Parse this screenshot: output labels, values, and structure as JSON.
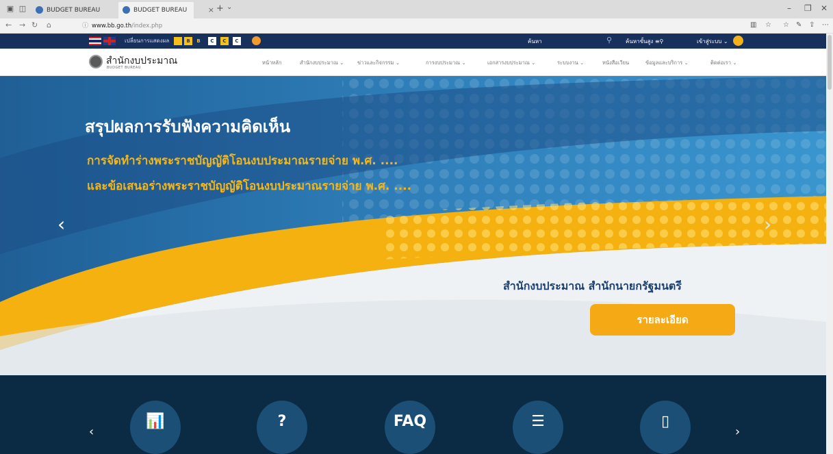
{
  "browser": {
    "tabs": [
      {
        "title": "BUDGET BUREAU"
      },
      {
        "title": "BUDGET BUREAU"
      }
    ],
    "url_domain": "www.bb.go.th",
    "url_path": "/index.php"
  },
  "topbar": {
    "color_label": "เปลี่ยนการแสดงผล",
    "color_boxes": [
      {
        "label": "",
        "bg": "#f5c017",
        "fg": "#17305c"
      },
      {
        "label": "B",
        "bg": "#f5c017",
        "fg": "#17305c"
      },
      {
        "label": "B",
        "bg": "#17305c",
        "fg": "#f5c017"
      },
      {
        "label": "C",
        "bg": "#ffffff",
        "fg": "#17305c"
      },
      {
        "label": "C",
        "bg": "#f5c017",
        "fg": "#17305c"
      },
      {
        "label": "C",
        "bg": "#ffffff",
        "fg": "#17305c"
      }
    ],
    "search_label": "ค้นหา",
    "advanced_search": "ค้นหาขั้นสูง",
    "login": "เข้าสู่ระบบ"
  },
  "logo": {
    "title": "สำนักงบประมาณ",
    "subtitle": "BUDGET BUREAU"
  },
  "menu": [
    "หน้าหลัก",
    "สำนักงบประมาณ",
    "ข่าวและกิจกรรม",
    "การงบประมาณ",
    "เอกสารงบประมาณ",
    "ระบบงาน",
    "หนังสือเวียน",
    "ข้อมูลและบริการ",
    "ติดต่อเรา"
  ],
  "hero": {
    "title": "สรุปผลการรับฟังความคิดเห็น",
    "line1": "การจัดทำร่างพระราชบัญญัติโอนงบประมาณรายจ่าย พ.ศ. ....",
    "line2": "และข้อเสนอร่างพระราชบัญญัติโอนงบประมาณรายจ่าย พ.ศ. ....",
    "org": "สำนักงบประมาณ สำนักนายกรัฐมนตรี",
    "button": "รายละเอียด"
  },
  "services": {
    "items": [
      {
        "icon": "report-chart-icon"
      },
      {
        "icon": "question-person-icon"
      },
      {
        "icon": "faq-icon",
        "label": "FAQ"
      },
      {
        "icon": "checklist-icon"
      },
      {
        "icon": "book-icon"
      }
    ]
  }
}
